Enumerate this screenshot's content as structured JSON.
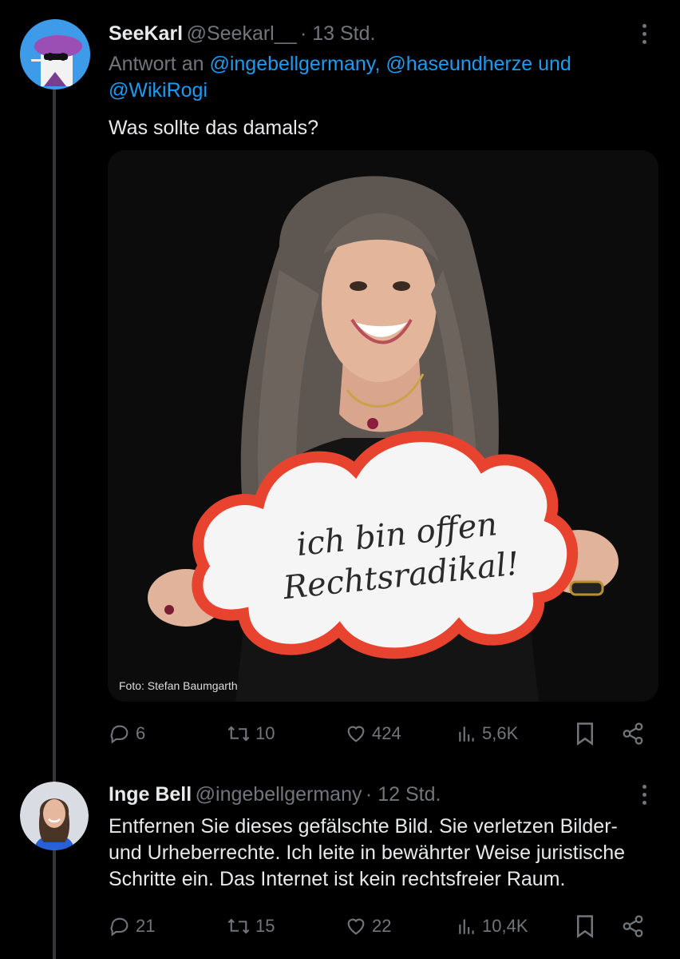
{
  "tweet1": {
    "name": "SeeKarl",
    "handle": "@Seekarl__",
    "time": "· 13 Std.",
    "reply_prefix": "Antwort an",
    "reply_handles_line1": "@ingebellgermany, @haseundherze und",
    "reply_handles_line2": "@WikiRogi",
    "text": "Was sollte das damals?",
    "image": {
      "sign_line1": "ich bin offen",
      "sign_line2": "Rechtsradikal!",
      "credit": "Foto: Stefan Baumgarth"
    },
    "actions": {
      "replies": "6",
      "reposts": "10",
      "likes": "424",
      "views": "5,6K"
    }
  },
  "tweet2": {
    "name": "Inge Bell",
    "handle": "@ingebellgermany",
    "time": "· 12 Std.",
    "text_line1": "Entfernen Sie dieses gefälschte Bild. Sie verletzen Bilder-",
    "text_line2": "und Urheberrechte. Ich leite in bewährter Weise juristische",
    "text_line3": "Schritte ein. Das Internet ist kein rechtsfreier Raum.",
    "actions": {
      "replies": "21",
      "reposts": "15",
      "likes": "22",
      "views": "10,4K"
    }
  },
  "icons": [
    "more-icon",
    "reply-icon",
    "repost-icon",
    "like-icon",
    "views-icon",
    "bookmark-icon",
    "share-icon"
  ],
  "colors": {
    "background": "#000000",
    "link": "#1d9bf0",
    "muted": "#71767b",
    "text": "#e7e9ea",
    "avatar_hat": "#9b4fb4",
    "sign_border": "#e8432f"
  }
}
